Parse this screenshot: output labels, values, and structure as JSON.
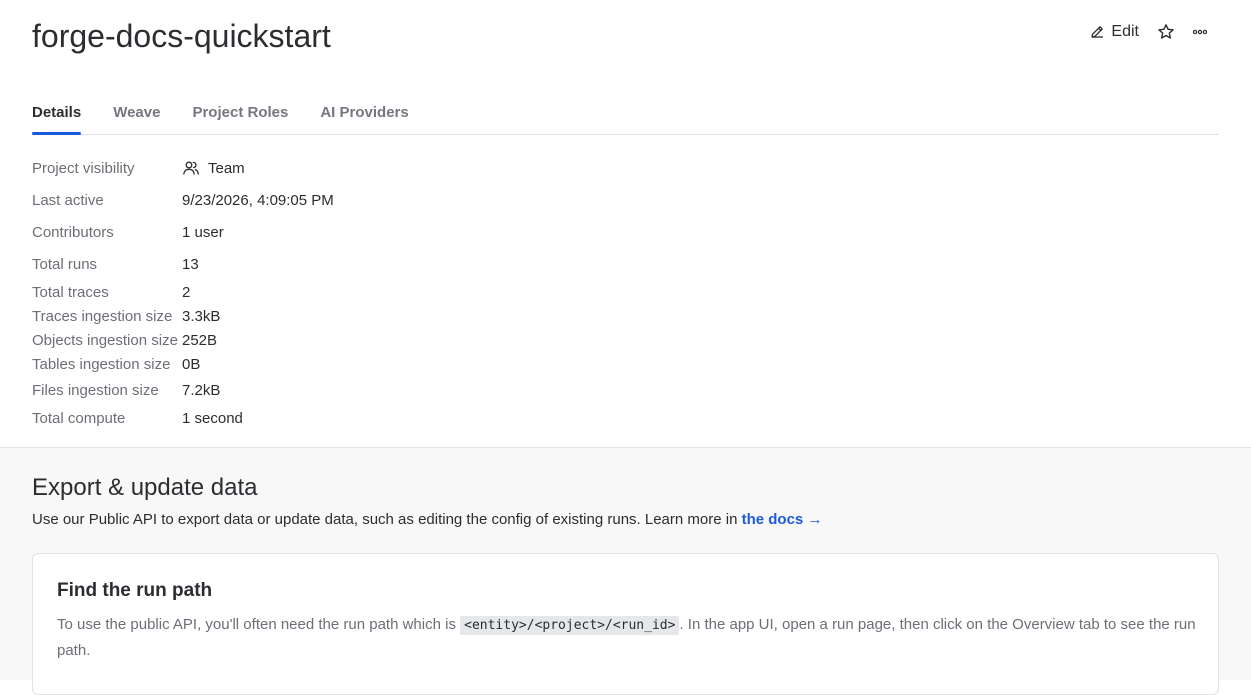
{
  "project": {
    "title": "forge-docs-quickstart",
    "edit_label": "Edit"
  },
  "icons": {
    "edit": "pencil-icon",
    "star": "star-icon",
    "more": "more-horizontal-icon",
    "team": "users-icon"
  },
  "tabs": [
    {
      "label": "Details",
      "active": true
    },
    {
      "label": "Weave",
      "active": false
    },
    {
      "label": "Project Roles",
      "active": false
    },
    {
      "label": "AI Providers",
      "active": false
    }
  ],
  "details": [
    {
      "label": "Project visibility",
      "value": "Team"
    },
    {
      "label": "Last active",
      "value": "9/23/2026, 4:09:05 PM"
    },
    {
      "label": "Contributors",
      "value": "1 user"
    },
    {
      "label": "Total runs",
      "value": "13"
    },
    {
      "label": "Total traces",
      "value": "2"
    },
    {
      "label": "Traces ingestion size",
      "value": "3.3kB"
    },
    {
      "label": "Objects ingestion size",
      "value": "252B"
    },
    {
      "label": "Tables ingestion size",
      "value": "0B"
    },
    {
      "label": "Files ingestion size",
      "value": "7.2kB"
    },
    {
      "label": "Total compute",
      "value": "1 second"
    }
  ],
  "export": {
    "title": "Export & update data",
    "desc_prefix": "Use our Public API to export data or update data, such as editing the config of existing runs. Learn more in ",
    "docs_link": "the docs →",
    "card": {
      "title": "Find the run path",
      "text_before": "To use the public API, you'll often need the run path which is ",
      "code": "<entity>/<project>/<run_id>",
      "text_after": ". In the app UI, open a run page, then click on the Overview tab to see the run path."
    }
  },
  "colors": {
    "accent": "#1d5ad9",
    "text": "#2b2d31",
    "muted": "#6c6f76",
    "border": "#e1e2e5"
  }
}
